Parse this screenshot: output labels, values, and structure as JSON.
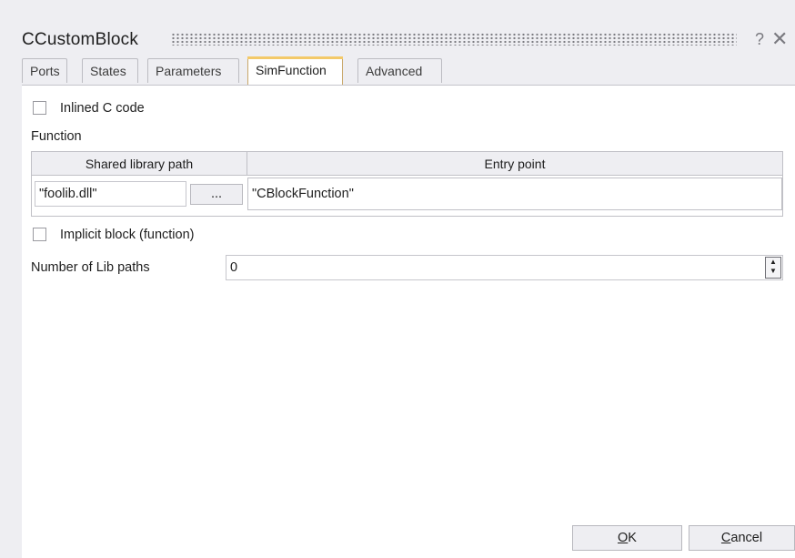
{
  "window": {
    "title": "CCustomBlock",
    "help_glyph": "?",
    "close_glyph": "✕"
  },
  "tabs": [
    {
      "label": "Ports"
    },
    {
      "label": "States"
    },
    {
      "label": "Parameters"
    },
    {
      "label": "SimFunction",
      "active": true
    },
    {
      "label": "Advanced"
    }
  ],
  "simfunction": {
    "inlined_c_code": {
      "label": "Inlined C code",
      "checked": false
    },
    "function_label": "Function",
    "table": {
      "headers": [
        "Shared library path",
        "Entry point"
      ],
      "shared_library_path": "\"foolib.dll\"",
      "browse_label": "...",
      "entry_point": "\"CBlockFunction\""
    },
    "implicit_block": {
      "label": "Implicit block (function)",
      "checked": false
    },
    "num_lib_paths": {
      "label": "Number of Lib paths",
      "value": "0"
    }
  },
  "buttons": {
    "ok": {
      "mnemonic": "O",
      "rest": "K"
    },
    "cancel": {
      "mnemonic": "C",
      "rest": "ancel"
    }
  },
  "icons": {
    "spinner": "up-down-spinner-icon"
  },
  "colors": {
    "dialog_bg": "#eeeef2",
    "active_tab_accent": "#f3c969",
    "content_bg": "#ffffff"
  }
}
